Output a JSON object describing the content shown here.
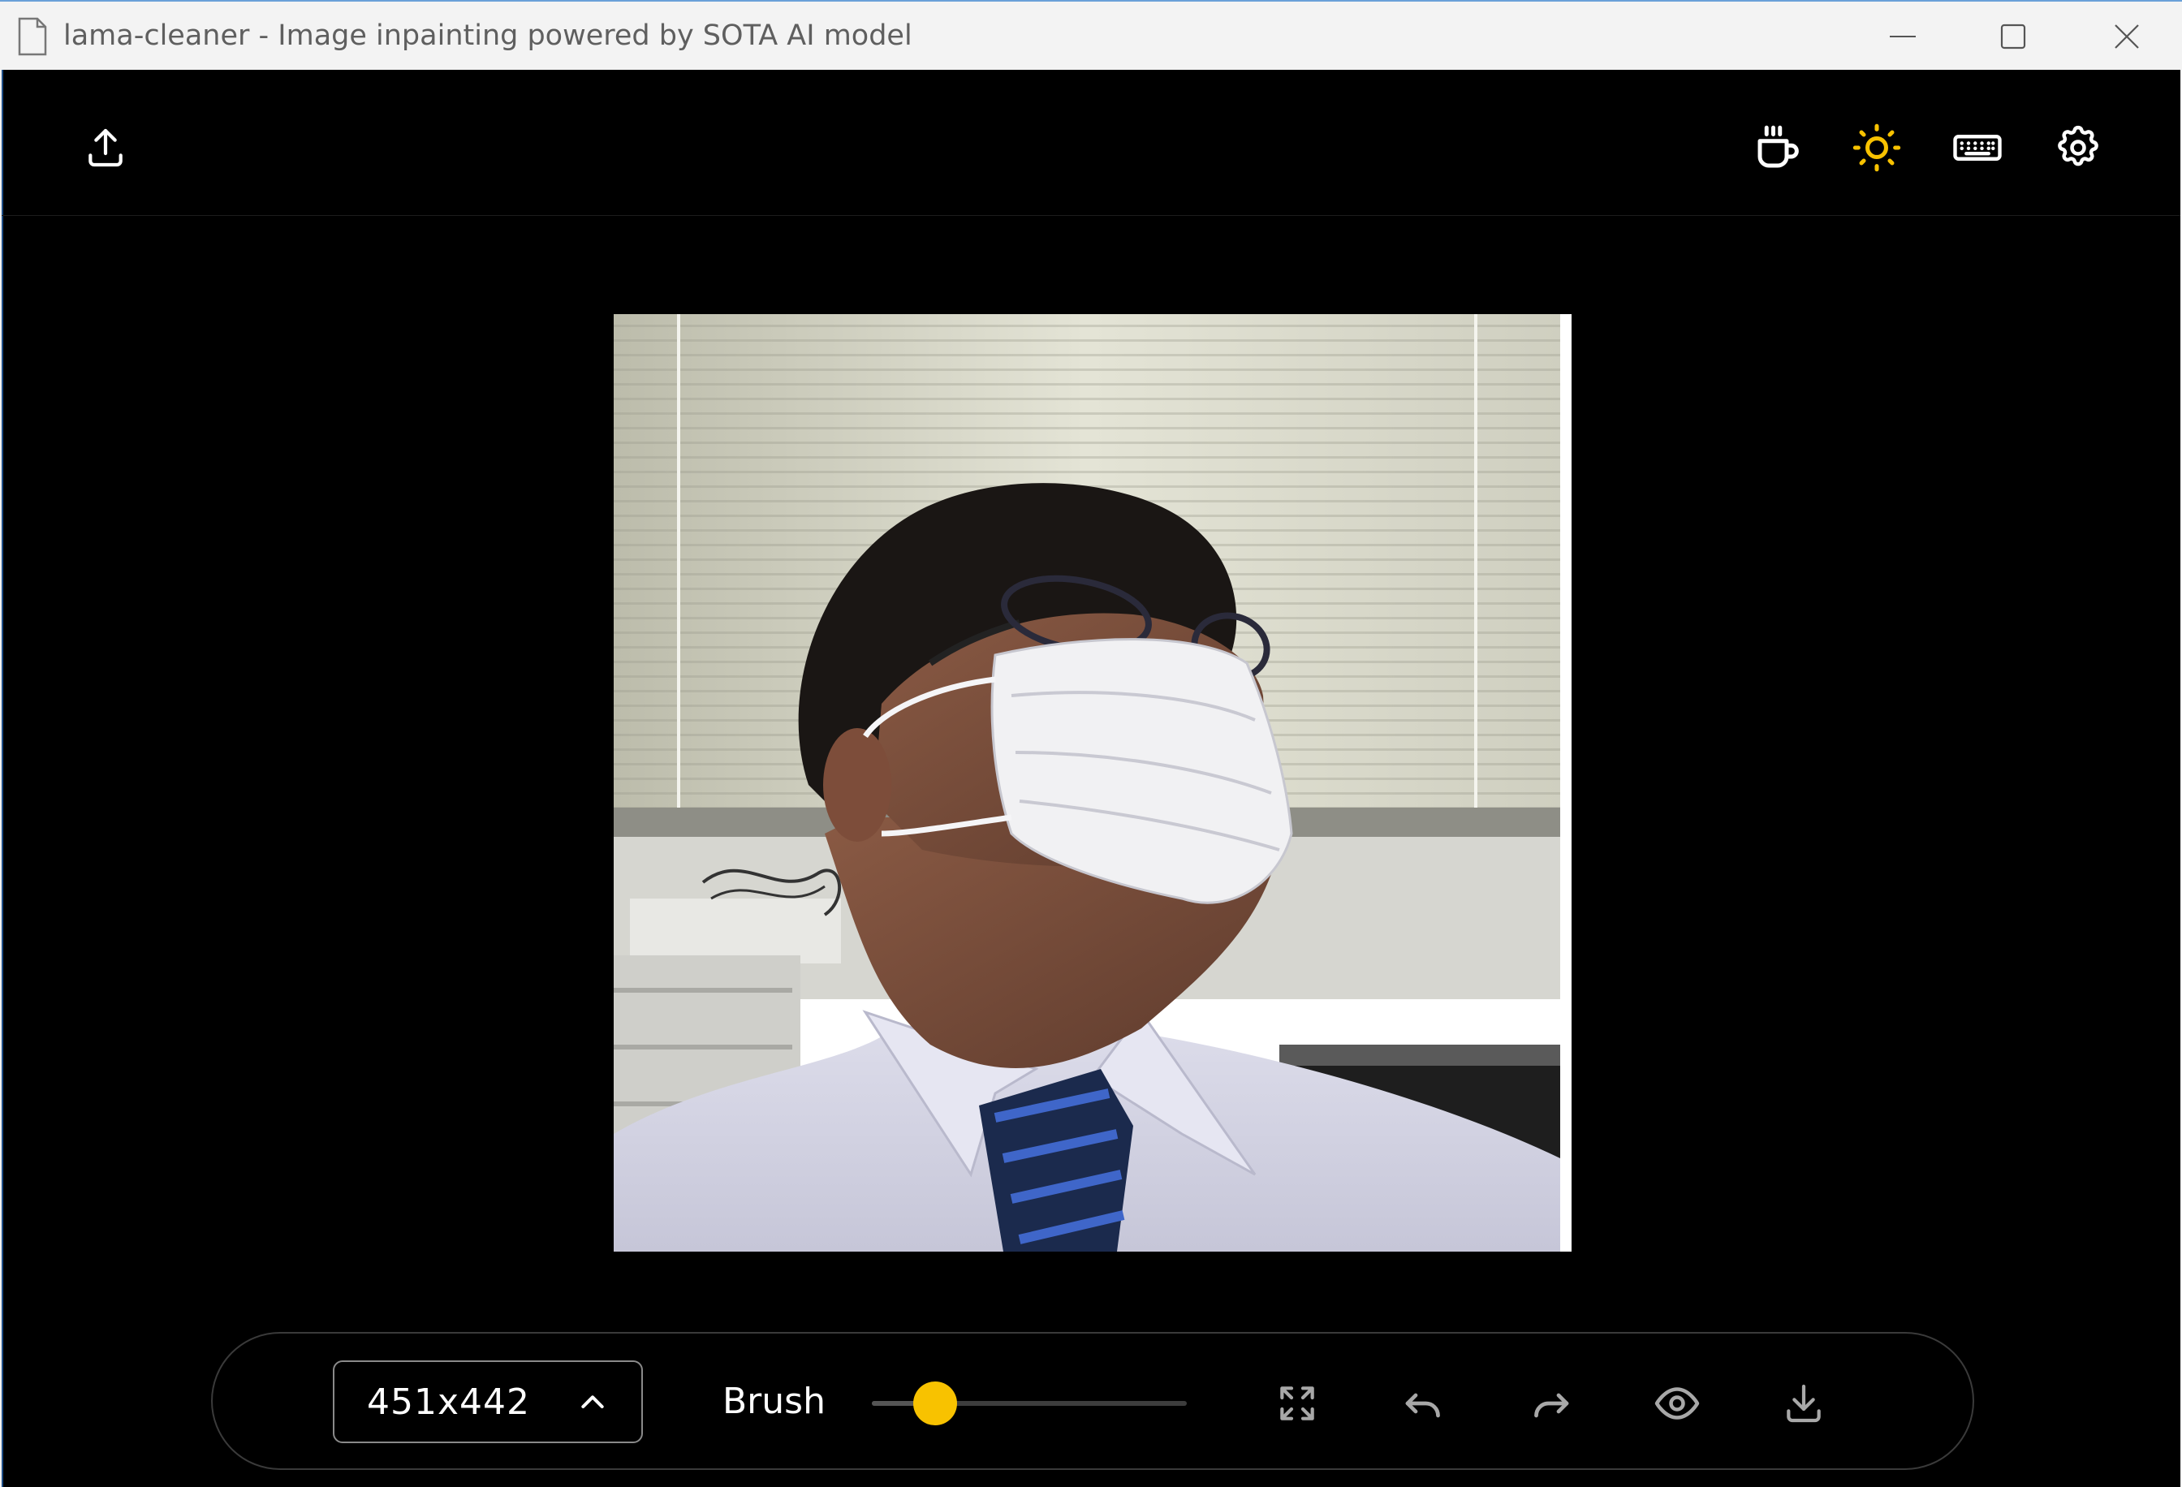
{
  "window": {
    "title": "lama-cleaner - Image inpainting powered by SOTA AI model",
    "controls": [
      "minimize",
      "maximize",
      "close"
    ]
  },
  "header": {
    "left_buttons": [
      {
        "icon": "upload-icon"
      }
    ],
    "right_buttons": [
      {
        "icon": "coffee-icon"
      },
      {
        "icon": "sun-icon",
        "color": "#f8c200"
      },
      {
        "icon": "keyboard-icon"
      },
      {
        "icon": "gear-icon"
      }
    ]
  },
  "canvas": {
    "image": "photo-person-wearing-mask"
  },
  "toolbar": {
    "size_value": "451x442",
    "brush_label": "Brush",
    "brush_value": 0.2,
    "accent_color": "#f8c200",
    "buttons": [
      "fullscreen-icon",
      "undo-icon",
      "redo-icon",
      "eye-icon",
      "download-icon"
    ]
  }
}
